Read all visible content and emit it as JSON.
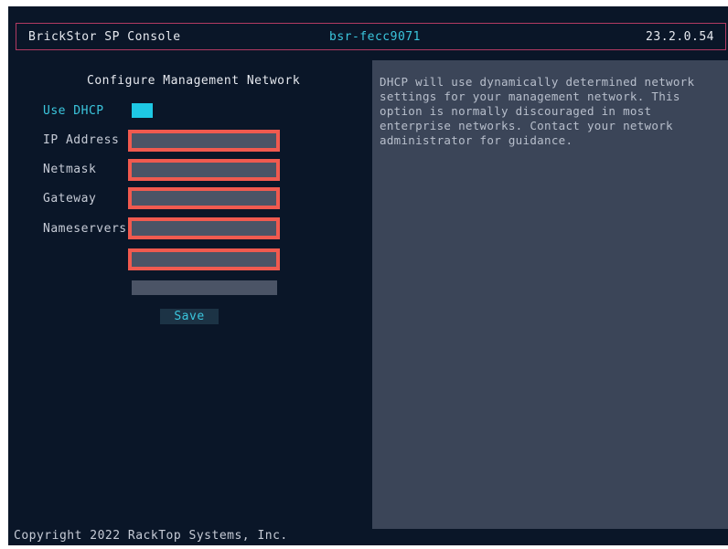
{
  "header": {
    "title": "BrickStor SP Console",
    "hostname": "bsr-fecc9071",
    "version": "23.2.0.54"
  },
  "form": {
    "title": "Configure Management Network",
    "use_dhcp_label": "Use DHCP",
    "use_dhcp_enabled": true,
    "ip_address_label": "IP Address",
    "ip_address_value": "",
    "netmask_label": "Netmask",
    "netmask_value": "",
    "gateway_label": "Gateway",
    "gateway_value": "",
    "nameservers_label": "Nameservers",
    "nameserver_1_value": "",
    "nameserver_2_value": "",
    "nameserver_3_value": "",
    "save_label": "Save"
  },
  "help": {
    "text": "DHCP will use dynamically determined network settings for your management network. This option is normally discouraged in most enterprise networks. Contact your network administrator for guidance."
  },
  "footer": {
    "copyright": "Copyright 2022 RackTop Systems, Inc."
  },
  "colors": {
    "background": "#0a1628",
    "accent": "#3bc6dd",
    "error_border": "#f05a4f",
    "header_border": "#b23a62",
    "panel": "#3b4558"
  }
}
